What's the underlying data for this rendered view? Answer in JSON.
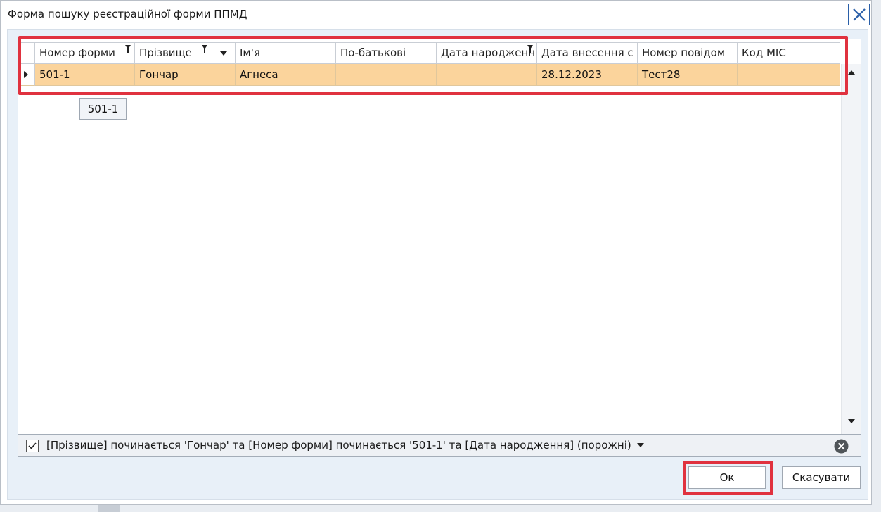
{
  "window": {
    "title": "Форма пошуку реєстраційної форми ППМД"
  },
  "grid": {
    "columns": [
      {
        "label": "Номер форми",
        "width": 142,
        "filtered": true,
        "sorted": false
      },
      {
        "label": "Прізвище",
        "width": 143,
        "filtered": true,
        "sorted": true
      },
      {
        "label": "Ім'я",
        "width": 143,
        "filtered": false,
        "sorted": false
      },
      {
        "label": "По-батькові",
        "width": 143,
        "filtered": false,
        "sorted": false
      },
      {
        "label": "Дата народження",
        "width": 143,
        "filtered": true,
        "sorted": false
      },
      {
        "label": "Дата внесення с",
        "width": 143,
        "filtered": false,
        "sorted": false
      },
      {
        "label": "Номер повідом",
        "width": 142,
        "filtered": false,
        "sorted": false
      },
      {
        "label": "Код МІС",
        "width": 146,
        "filtered": false,
        "sorted": false
      }
    ],
    "rows": [
      [
        "501-1",
        "Гончар",
        "Агнеса",
        "",
        "",
        "28.12.2023",
        "Тест28",
        ""
      ]
    ],
    "tooltip": "501-1"
  },
  "filter": {
    "checked": true,
    "text": "[Прізвище] починається 'Гончар' та [Номер форми] починається '501-1' та [Дата народження] (порожні)"
  },
  "buttons": {
    "ok": "Ок",
    "cancel": "Скасувати"
  },
  "colors": {
    "selected_row": "#fbd49c",
    "highlight": "#e0323f",
    "panel": "#e8f0f8"
  }
}
